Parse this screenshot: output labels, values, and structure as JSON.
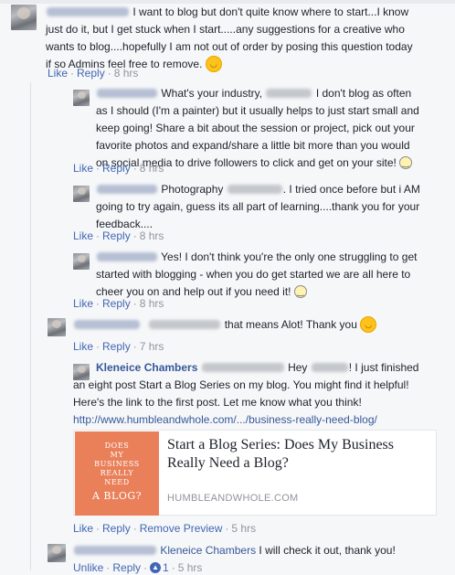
{
  "comments": [
    {
      "id": "c1",
      "body": "I want to blog but don't quite know where to start...I know just do it, but I get stuck when I start.....any suggestions for a creative who wants to blog....hopefully I am not out of order by posing this question today if so Admins feel free to remove.",
      "actions": {
        "like": "Like",
        "reply": "Reply",
        "time": "8 hrs"
      }
    },
    {
      "id": "r1",
      "body_a": "What's your industry,",
      "body_b": "I don't blog as often as I should (I'm a painter) but it usually helps to just start small and keep going! Share a bit about the session or project, pick out your favorite photos and expand/share a little bit more than you would on social media to drive followers to click and get on your site!",
      "actions": {
        "like": "Like",
        "reply": "Reply",
        "time": "8 hrs"
      }
    },
    {
      "id": "r2",
      "body_a": "Photography",
      "body_b": ". I tried once before but i AM going to try again, guess its all part of learning....thank you for your feedback....",
      "actions": {
        "like": "Like",
        "reply": "Reply",
        "time": "8 hrs"
      }
    },
    {
      "id": "r3",
      "body": "Yes! I don't think you're the only one struggling to get started with blogging - when you do get started we are all here to cheer you on and help out if you need it!",
      "actions": {
        "like": "Like",
        "reply": "Reply",
        "time": "8 hrs"
      }
    },
    {
      "id": "r4",
      "body": "that means Alot! Thank you",
      "actions": {
        "like": "Like",
        "reply": "Reply",
        "time": "7 hrs"
      }
    },
    {
      "id": "r5",
      "author": "Kleneice Chambers",
      "body_a": "Hey",
      "body_b": "! I just finished an eight post Start a Blog Series on my blog. You might find it helpful! Here's the link to the first post. Let me know what you think!",
      "url": "http://www.humbleandwhole.com/.../business-really-need-blog/",
      "preview": {
        "img_lines": [
          "DOES",
          "MY",
          "BUSINESS",
          "REALLY",
          "NEED"
        ],
        "img_big": "A BLOG?",
        "title": "Start a Blog Series: Does My Business Really Need a Blog?",
        "domain": "HUMBLEANDWHOLE.COM"
      },
      "actions": {
        "like": "Like",
        "reply": "Reply",
        "remove_preview": "Remove Preview",
        "time": "5 hrs"
      }
    },
    {
      "id": "r6",
      "mention": "Kleneice Chambers",
      "body": "I will check it out, thank you!",
      "actions": {
        "unlike": "Unlike",
        "reply": "Reply",
        "like_count": "1",
        "time": "5 hrs"
      }
    }
  ],
  "colors": {
    "link": "#365899",
    "action": "#4267b2",
    "meta": "#90949c",
    "preview_bg": "#e9805a"
  },
  "icons": [
    "hugging-face-emoji",
    "slightly-smiling-emoji",
    "like-thumb-icon"
  ]
}
